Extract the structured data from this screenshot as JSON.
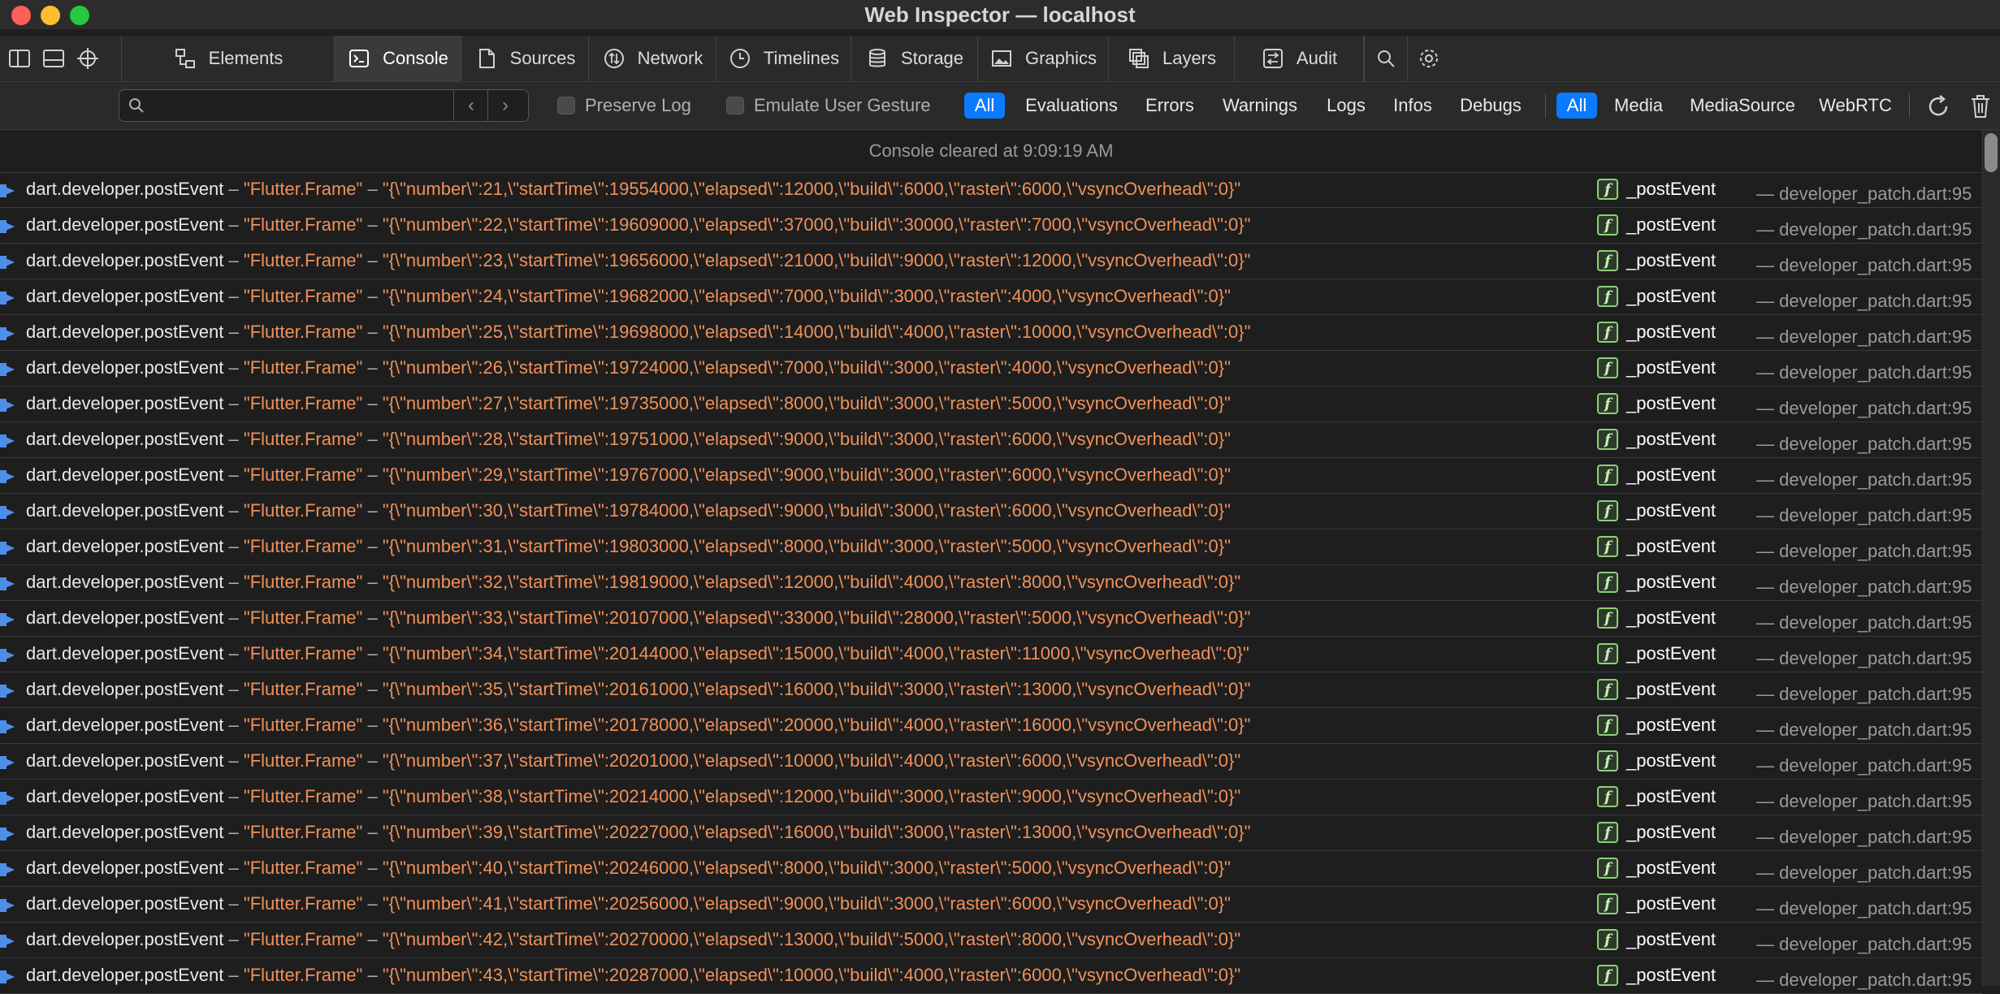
{
  "window": {
    "title": "Web Inspector — localhost"
  },
  "tabs": [
    {
      "label": "Elements",
      "icon": "elements-icon"
    },
    {
      "label": "Console",
      "icon": "console-icon",
      "active": true
    },
    {
      "label": "Sources",
      "icon": "document-icon"
    },
    {
      "label": "Network",
      "icon": "network-icon"
    },
    {
      "label": "Timelines",
      "icon": "clock-icon"
    },
    {
      "label": "Storage",
      "icon": "database-icon"
    },
    {
      "label": "Graphics",
      "icon": "image-icon"
    },
    {
      "label": "Layers",
      "icon": "layers-icon"
    },
    {
      "label": "Audit",
      "icon": "audit-icon"
    }
  ],
  "filter": {
    "search_placeholder": "",
    "preserve_log": "Preserve Log",
    "emulate_gesture": "Emulate User Gesture",
    "levels": [
      "All",
      "Evaluations",
      "Errors",
      "Warnings",
      "Logs",
      "Infos",
      "Debugs"
    ],
    "sources": [
      "All",
      "Media",
      "MediaSource",
      "WebRTC"
    ]
  },
  "console": {
    "cleared_text": "Console cleared at 9:09:19 AM",
    "rows": [
      {
        "fn": "dart.developer.postEvent",
        "dash1": "–",
        "name": "\"Flutter.Frame\"",
        "dash2": "–",
        "payload": "\"{\\\"number\\\":21,\\\"startTime\\\":19554000,\\\"elapsed\\\":12000,\\\"build\\\":6000,\\\"raster\\\":6000,\\\"vsyncOverhead\\\":0}\"",
        "loc": "_postEvent",
        "file": "— developer_patch.dart:95"
      },
      {
        "fn": "dart.developer.postEvent",
        "dash1": "–",
        "name": "\"Flutter.Frame\"",
        "dash2": "–",
        "payload": "\"{\\\"number\\\":22,\\\"startTime\\\":19609000,\\\"elapsed\\\":37000,\\\"build\\\":30000,\\\"raster\\\":7000,\\\"vsyncOverhead\\\":0}\"",
        "loc": "_postEvent",
        "file": "— developer_patch.dart:95"
      },
      {
        "fn": "dart.developer.postEvent",
        "dash1": "–",
        "name": "\"Flutter.Frame\"",
        "dash2": "–",
        "payload": "\"{\\\"number\\\":23,\\\"startTime\\\":19656000,\\\"elapsed\\\":21000,\\\"build\\\":9000,\\\"raster\\\":12000,\\\"vsyncOverhead\\\":0}\"",
        "loc": "_postEvent",
        "file": "— developer_patch.dart:95"
      },
      {
        "fn": "dart.developer.postEvent",
        "dash1": "–",
        "name": "\"Flutter.Frame\"",
        "dash2": "–",
        "payload": "\"{\\\"number\\\":24,\\\"startTime\\\":19682000,\\\"elapsed\\\":7000,\\\"build\\\":3000,\\\"raster\\\":4000,\\\"vsyncOverhead\\\":0}\"",
        "loc": "_postEvent",
        "file": "— developer_patch.dart:95"
      },
      {
        "fn": "dart.developer.postEvent",
        "dash1": "–",
        "name": "\"Flutter.Frame\"",
        "dash2": "–",
        "payload": "\"{\\\"number\\\":25,\\\"startTime\\\":19698000,\\\"elapsed\\\":14000,\\\"build\\\":4000,\\\"raster\\\":10000,\\\"vsyncOverhead\\\":0}\"",
        "loc": "_postEvent",
        "file": "— developer_patch.dart:95"
      },
      {
        "fn": "dart.developer.postEvent",
        "dash1": "–",
        "name": "\"Flutter.Frame\"",
        "dash2": "–",
        "payload": "\"{\\\"number\\\":26,\\\"startTime\\\":19724000,\\\"elapsed\\\":7000,\\\"build\\\":3000,\\\"raster\\\":4000,\\\"vsyncOverhead\\\":0}\"",
        "loc": "_postEvent",
        "file": "— developer_patch.dart:95"
      },
      {
        "fn": "dart.developer.postEvent",
        "dash1": "–",
        "name": "\"Flutter.Frame\"",
        "dash2": "–",
        "payload": "\"{\\\"number\\\":27,\\\"startTime\\\":19735000,\\\"elapsed\\\":8000,\\\"build\\\":3000,\\\"raster\\\":5000,\\\"vsyncOverhead\\\":0}\"",
        "loc": "_postEvent",
        "file": "— developer_patch.dart:95"
      },
      {
        "fn": "dart.developer.postEvent",
        "dash1": "–",
        "name": "\"Flutter.Frame\"",
        "dash2": "–",
        "payload": "\"{\\\"number\\\":28,\\\"startTime\\\":19751000,\\\"elapsed\\\":9000,\\\"build\\\":3000,\\\"raster\\\":6000,\\\"vsyncOverhead\\\":0}\"",
        "loc": "_postEvent",
        "file": "— developer_patch.dart:95"
      },
      {
        "fn": "dart.developer.postEvent",
        "dash1": "–",
        "name": "\"Flutter.Frame\"",
        "dash2": "–",
        "payload": "\"{\\\"number\\\":29,\\\"startTime\\\":19767000,\\\"elapsed\\\":9000,\\\"build\\\":3000,\\\"raster\\\":6000,\\\"vsyncOverhead\\\":0}\"",
        "loc": "_postEvent",
        "file": "— developer_patch.dart:95"
      },
      {
        "fn": "dart.developer.postEvent",
        "dash1": "–",
        "name": "\"Flutter.Frame\"",
        "dash2": "–",
        "payload": "\"{\\\"number\\\":30,\\\"startTime\\\":19784000,\\\"elapsed\\\":9000,\\\"build\\\":3000,\\\"raster\\\":6000,\\\"vsyncOverhead\\\":0}\"",
        "loc": "_postEvent",
        "file": "— developer_patch.dart:95"
      },
      {
        "fn": "dart.developer.postEvent",
        "dash1": "–",
        "name": "\"Flutter.Frame\"",
        "dash2": "–",
        "payload": "\"{\\\"number\\\":31,\\\"startTime\\\":19803000,\\\"elapsed\\\":8000,\\\"build\\\":3000,\\\"raster\\\":5000,\\\"vsyncOverhead\\\":0}\"",
        "loc": "_postEvent",
        "file": "— developer_patch.dart:95"
      },
      {
        "fn": "dart.developer.postEvent",
        "dash1": "–",
        "name": "\"Flutter.Frame\"",
        "dash2": "–",
        "payload": "\"{\\\"number\\\":32,\\\"startTime\\\":19819000,\\\"elapsed\\\":12000,\\\"build\\\":4000,\\\"raster\\\":8000,\\\"vsyncOverhead\\\":0}\"",
        "loc": "_postEvent",
        "file": "— developer_patch.dart:95"
      },
      {
        "fn": "dart.developer.postEvent",
        "dash1": "–",
        "name": "\"Flutter.Frame\"",
        "dash2": "–",
        "payload": "\"{\\\"number\\\":33,\\\"startTime\\\":20107000,\\\"elapsed\\\":33000,\\\"build\\\":28000,\\\"raster\\\":5000,\\\"vsyncOverhead\\\":0}\"",
        "loc": "_postEvent",
        "file": "— developer_patch.dart:95"
      },
      {
        "fn": "dart.developer.postEvent",
        "dash1": "–",
        "name": "\"Flutter.Frame\"",
        "dash2": "–",
        "payload": "\"{\\\"number\\\":34,\\\"startTime\\\":20144000,\\\"elapsed\\\":15000,\\\"build\\\":4000,\\\"raster\\\":11000,\\\"vsyncOverhead\\\":0}\"",
        "loc": "_postEvent",
        "file": "— developer_patch.dart:95"
      },
      {
        "fn": "dart.developer.postEvent",
        "dash1": "–",
        "name": "\"Flutter.Frame\"",
        "dash2": "–",
        "payload": "\"{\\\"number\\\":35,\\\"startTime\\\":20161000,\\\"elapsed\\\":16000,\\\"build\\\":3000,\\\"raster\\\":13000,\\\"vsyncOverhead\\\":0}\"",
        "loc": "_postEvent",
        "file": "— developer_patch.dart:95"
      },
      {
        "fn": "dart.developer.postEvent",
        "dash1": "–",
        "name": "\"Flutter.Frame\"",
        "dash2": "–",
        "payload": "\"{\\\"number\\\":36,\\\"startTime\\\":20178000,\\\"elapsed\\\":20000,\\\"build\\\":4000,\\\"raster\\\":16000,\\\"vsyncOverhead\\\":0}\"",
        "loc": "_postEvent",
        "file": "— developer_patch.dart:95"
      },
      {
        "fn": "dart.developer.postEvent",
        "dash1": "–",
        "name": "\"Flutter.Frame\"",
        "dash2": "–",
        "payload": "\"{\\\"number\\\":37,\\\"startTime\\\":20201000,\\\"elapsed\\\":10000,\\\"build\\\":4000,\\\"raster\\\":6000,\\\"vsyncOverhead\\\":0}\"",
        "loc": "_postEvent",
        "file": "— developer_patch.dart:95"
      },
      {
        "fn": "dart.developer.postEvent",
        "dash1": "–",
        "name": "\"Flutter.Frame\"",
        "dash2": "–",
        "payload": "\"{\\\"number\\\":38,\\\"startTime\\\":20214000,\\\"elapsed\\\":12000,\\\"build\\\":3000,\\\"raster\\\":9000,\\\"vsyncOverhead\\\":0}\"",
        "loc": "_postEvent",
        "file": "— developer_patch.dart:95"
      },
      {
        "fn": "dart.developer.postEvent",
        "dash1": "–",
        "name": "\"Flutter.Frame\"",
        "dash2": "–",
        "payload": "\"{\\\"number\\\":39,\\\"startTime\\\":20227000,\\\"elapsed\\\":16000,\\\"build\\\":3000,\\\"raster\\\":13000,\\\"vsyncOverhead\\\":0}\"",
        "loc": "_postEvent",
        "file": "— developer_patch.dart:95"
      },
      {
        "fn": "dart.developer.postEvent",
        "dash1": "–",
        "name": "\"Flutter.Frame\"",
        "dash2": "–",
        "payload": "\"{\\\"number\\\":40,\\\"startTime\\\":20246000,\\\"elapsed\\\":8000,\\\"build\\\":3000,\\\"raster\\\":5000,\\\"vsyncOverhead\\\":0}\"",
        "loc": "_postEvent",
        "file": "— developer_patch.dart:95"
      },
      {
        "fn": "dart.developer.postEvent",
        "dash1": "–",
        "name": "\"Flutter.Frame\"",
        "dash2": "–",
        "payload": "\"{\\\"number\\\":41,\\\"startTime\\\":20256000,\\\"elapsed\\\":9000,\\\"build\\\":3000,\\\"raster\\\":6000,\\\"vsyncOverhead\\\":0}\"",
        "loc": "_postEvent",
        "file": "— developer_patch.dart:95"
      },
      {
        "fn": "dart.developer.postEvent",
        "dash1": "–",
        "name": "\"Flutter.Frame\"",
        "dash2": "–",
        "payload": "\"{\\\"number\\\":42,\\\"startTime\\\":20270000,\\\"elapsed\\\":13000,\\\"build\\\":5000,\\\"raster\\\":8000,\\\"vsyncOverhead\\\":0}\"",
        "loc": "_postEvent",
        "file": "— developer_patch.dart:95"
      },
      {
        "fn": "dart.developer.postEvent",
        "dash1": "–",
        "name": "\"Flutter.Frame\"",
        "dash2": "–",
        "payload": "\"{\\\"number\\\":43,\\\"startTime\\\":20287000,\\\"elapsed\\\":10000,\\\"build\\\":4000,\\\"raster\\\":6000,\\\"vsyncOverhead\\\":0}\"",
        "loc": "_postEvent",
        "file": "— developer_patch.dart:95"
      }
    ]
  }
}
